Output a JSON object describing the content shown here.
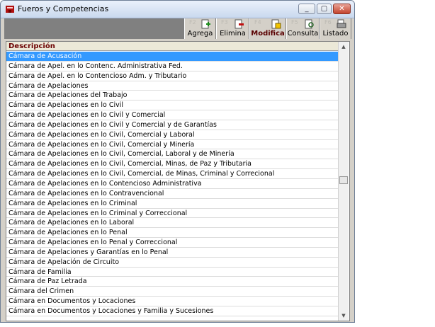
{
  "window": {
    "title": "Fueros y Competencias"
  },
  "colors": {
    "selection": "#3399ff",
    "header_text": "#6b0000",
    "toolbar_bg": "#808080"
  },
  "toolbar": {
    "buttons": [
      {
        "label": "Agrega",
        "icon": "add-doc-icon",
        "key": "F2"
      },
      {
        "label": "Elimina",
        "icon": "delete-doc-icon",
        "key": "F3"
      },
      {
        "label": "Modifica",
        "icon": "edit-doc-icon",
        "key": "F4"
      },
      {
        "label": "Consulta",
        "icon": "query-doc-icon",
        "key": "F5"
      },
      {
        "label": "Listado",
        "icon": "list-print-icon",
        "key": "F6"
      }
    ]
  },
  "grid": {
    "header": "Descripción",
    "rows": [
      "Cámara de Acusación",
      "Cámara de Apel. en lo Contenc. Administrativa Fed.",
      "Cámara de Apel. en lo Contencioso Adm. y Tributario",
      "Cámara de Apelaciones",
      "Cámara de Apelaciones del Trabajo",
      "Cámara de Apelaciones en lo Civil",
      "Cámara de Apelaciones en lo Civil y Comercial",
      "Cámara de Apelaciones en lo Civil y Comercial y de Garantías",
      "Cámara de Apelaciones en lo Civil, Comercial y Laboral",
      "Cámara de Apelaciones en lo Civil, Comercial y Minería",
      "Cámara de Apelaciones en lo Civil, Comercial, Laboral y de Minería",
      "Cámara de Apelaciones en lo Civil, Comercial, Minas, de Paz y Tributaria",
      "Cámara de Apelaciones en lo Civil, Comercial, de Minas, Criminal y Correcional",
      "Cámara de Apelaciones en lo Contencioso Administrativa",
      "Cámara de Apelaciones en lo Contravencional",
      "Cámara de Apelaciones en lo Criminal",
      "Cámara de Apelaciones en lo Criminal y Correccional",
      "Cámara de Apelaciones en lo Laboral",
      "Cámara de Apelaciones en lo Penal",
      "Cámara de Apelaciones en lo Penal y Correccional",
      "Cámara de Apelaciones y Garantías en lo Penal",
      "Cámara de Apelación de Circuito",
      "Cámara de Familia",
      "Cámara de Paz Letrada",
      "Cámara del Crimen",
      "Cámara en Documentos y Locaciones",
      "Cámara en Documentos y Locaciones y Familia y Sucesiones"
    ],
    "selected_index": 0
  }
}
